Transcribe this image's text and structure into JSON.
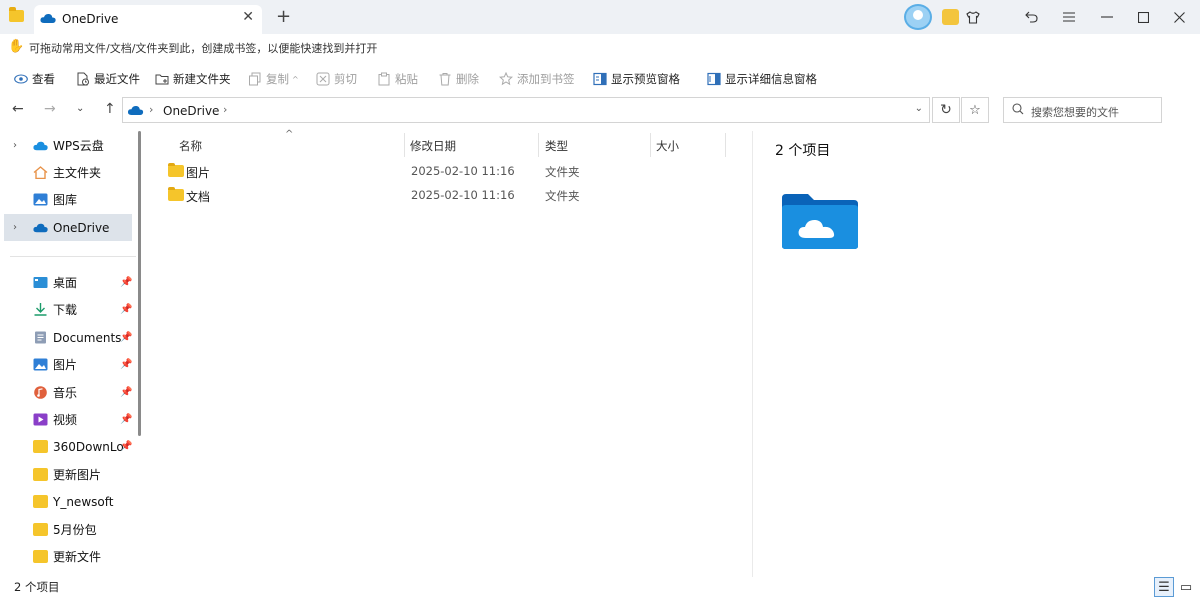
{
  "titlebar": {
    "tab_title": "OneDrive",
    "tab_close": "✕",
    "new_tab": "+",
    "buttons": [
      "skin",
      "undo",
      "menu",
      "minimize",
      "maximize",
      "close"
    ]
  },
  "hint": {
    "text": "可拖动常用文件/文档/文件夹到此，创建成书签，以便能快速找到并打开"
  },
  "toolbar": {
    "view": "查看",
    "recent": "最近文件",
    "new_folder": "新建文件夹",
    "copy": "复制",
    "cut": "剪切",
    "paste": "粘贴",
    "delete": "删除",
    "bookmark": "添加到书签",
    "preview_pane": "显示预览窗格",
    "details_pane": "显示详细信息窗格"
  },
  "nav": {
    "breadcrumb": [
      "OneDrive"
    ],
    "search_placeholder": "搜索您想要的文件"
  },
  "sidebar": {
    "top": [
      {
        "label": "WPS云盘",
        "expandable": true,
        "icon": "cloud-icon",
        "color": "#1a8fe0"
      },
      {
        "label": "主文件夹",
        "expandable": false,
        "icon": "home-icon",
        "color": "#e8934a"
      },
      {
        "label": "图库",
        "expandable": false,
        "icon": "gallery-icon",
        "color": "#2f7fd6"
      },
      {
        "label": "OneDrive",
        "expandable": true,
        "icon": "onedrive-icon",
        "color": "#0f6cbd",
        "selected": true
      }
    ],
    "quick": [
      {
        "label": "桌面",
        "icon": "desktop-icon",
        "pinned": true
      },
      {
        "label": "下载",
        "icon": "download-icon",
        "pinned": true
      },
      {
        "label": "Documents",
        "icon": "documents-icon",
        "pinned": true
      },
      {
        "label": "图片",
        "icon": "pictures-icon",
        "pinned": true
      },
      {
        "label": "音乐",
        "icon": "music-icon",
        "pinned": true
      },
      {
        "label": "视频",
        "icon": "video-icon",
        "pinned": true
      },
      {
        "label": "360DownLo",
        "icon": "folder-icon",
        "pinned": true
      },
      {
        "label": "更新图片",
        "icon": "folder-icon",
        "pinned": false
      },
      {
        "label": "Y_newsoft",
        "icon": "folder-icon",
        "pinned": false
      },
      {
        "label": "5月份包",
        "icon": "folder-icon",
        "pinned": false
      },
      {
        "label": "更新文件",
        "icon": "folder-icon",
        "pinned": false
      }
    ]
  },
  "filelist": {
    "columns": [
      "名称",
      "修改日期",
      "类型",
      "大小"
    ],
    "rows": [
      {
        "name": "图片",
        "date": "2025-02-10 11:16",
        "type": "文件夹",
        "size": ""
      },
      {
        "name": "文档",
        "date": "2025-02-10 11:16",
        "type": "文件夹",
        "size": ""
      }
    ]
  },
  "preview": {
    "count": "2 个项目"
  },
  "status": {
    "count": "2 个项目"
  },
  "colors": {
    "accent": "#0f6cbd",
    "folder": "#f5c52b",
    "selected_bg": "#dde3ea"
  }
}
